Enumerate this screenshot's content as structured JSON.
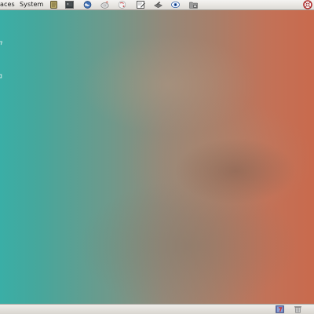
{
  "top_panel": {
    "menus": {
      "places_label": "aces",
      "system_label": "System"
    },
    "launchers": [
      {
        "name": "notes-icon"
      },
      {
        "name": "terminal-icon"
      },
      {
        "name": "web-browser-icon"
      },
      {
        "name": "disc-burner-icon"
      },
      {
        "name": "help-icon"
      },
      {
        "name": "text-editor-icon"
      },
      {
        "name": "package-manager-icon"
      },
      {
        "name": "network-monitor-icon"
      },
      {
        "name": "file-manager-icon"
      }
    ],
    "tray": {
      "icon": "lifebuoy-icon"
    }
  },
  "desktop": {
    "colors": {
      "left": "#3aaea6",
      "right": "#c96a4d"
    }
  },
  "bottom_panel": {
    "icons": [
      {
        "name": "workspace-switcher-icon"
      },
      {
        "name": "trash-icon"
      }
    ]
  }
}
